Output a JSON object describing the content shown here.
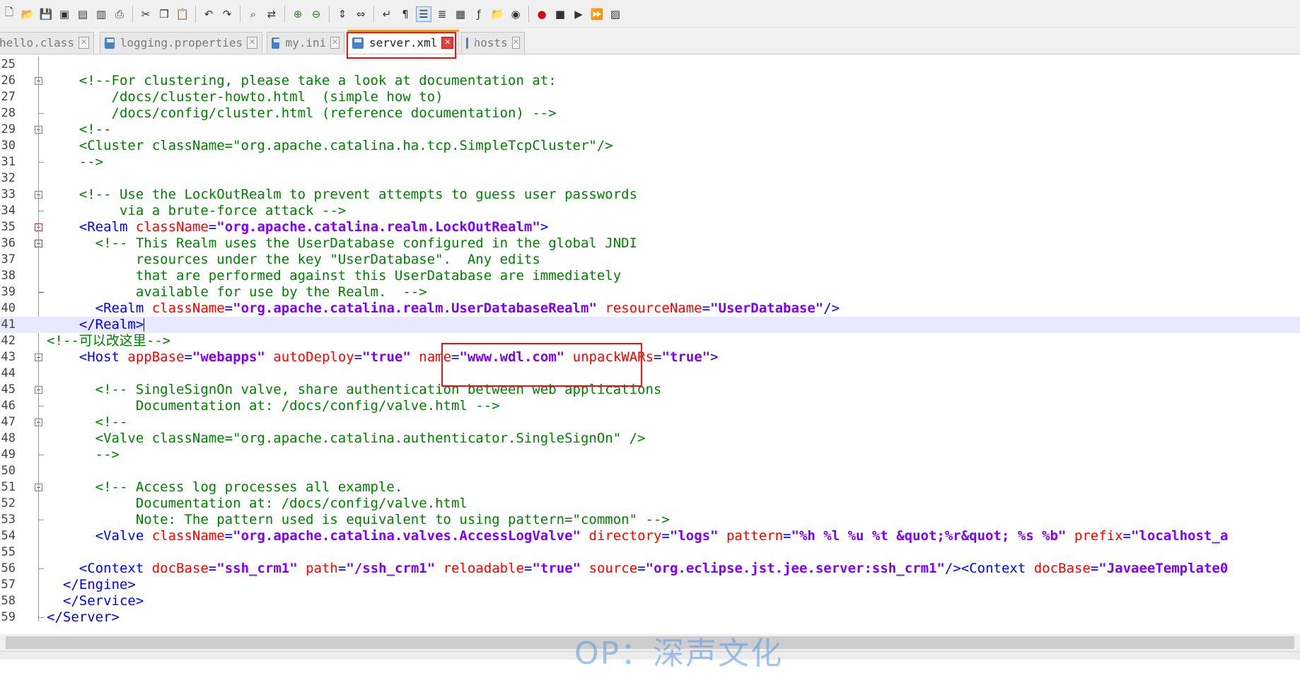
{
  "toolbar": {
    "icons": [
      "new-file-icon",
      "open-file-icon",
      "save-icon",
      "save-all-icon",
      "close-icon",
      "close-all-icon",
      "print-icon",
      "cut-icon",
      "copy-icon",
      "paste-icon",
      "undo-icon",
      "redo-icon",
      "find-icon",
      "replace-icon",
      "zoom-in-icon",
      "zoom-out-icon",
      "sync-vertical-icon",
      "sync-horizontal-icon",
      "word-wrap-icon",
      "show-all-chars-icon",
      "indent-guide-icon",
      "user-language-icon",
      "doc-map-icon",
      "function-list-icon",
      "folder-workspace-icon",
      "monitoring-icon",
      "record-macro-icon",
      "stop-macro-icon",
      "play-macro-icon",
      "run-macro-multiple-icon",
      "save-macro-icon"
    ]
  },
  "tabs": [
    {
      "label": "hello.class",
      "active": false
    },
    {
      "label": "logging.properties",
      "active": false
    },
    {
      "label": "my.ini",
      "active": false
    },
    {
      "label": "server.xml",
      "active": true
    },
    {
      "label": "hosts",
      "active": false
    }
  ],
  "editor": {
    "lines": [
      {
        "n": "25",
        "segs": []
      },
      {
        "n": "26",
        "segs": [
          [
            "cm",
            "    <!--For clustering, please take a look at documentation at:"
          ]
        ]
      },
      {
        "n": "27",
        "segs": [
          [
            "cm",
            "        /docs/cluster-howto.html  (simple how to)"
          ]
        ]
      },
      {
        "n": "28",
        "segs": [
          [
            "cm",
            "        /docs/config/cluster.html (reference documentation) -->"
          ]
        ]
      },
      {
        "n": "29",
        "segs": [
          [
            "cm",
            "    <!--"
          ]
        ]
      },
      {
        "n": "30",
        "segs": [
          [
            "cm",
            "    <Cluster className=\"org.apache.catalina.ha.tcp.SimpleTcpCluster\"/>"
          ]
        ]
      },
      {
        "n": "31",
        "segs": [
          [
            "cm",
            "    -->"
          ]
        ]
      },
      {
        "n": "32",
        "segs": []
      },
      {
        "n": "33",
        "segs": [
          [
            "cm",
            "    <!-- Use the LockOutRealm to prevent attempts to guess user passwords"
          ]
        ]
      },
      {
        "n": "34",
        "segs": [
          [
            "cm",
            "         via a brute-force attack -->"
          ]
        ]
      },
      {
        "n": "35",
        "segs": [
          [
            "tag",
            "    <Realm "
          ],
          [
            "attr",
            "className"
          ],
          [
            "tag",
            "="
          ],
          [
            "val",
            "\"org.apache.catalina.realm.LockOutRealm\""
          ],
          [
            "tag",
            ">"
          ]
        ]
      },
      {
        "n": "36",
        "segs": [
          [
            "cm",
            "      <!-- This Realm uses the UserDatabase configured in the global JNDI"
          ]
        ]
      },
      {
        "n": "37",
        "segs": [
          [
            "cm",
            "           resources under the key \"UserDatabase\".  Any edits"
          ]
        ]
      },
      {
        "n": "38",
        "segs": [
          [
            "cm",
            "           that are performed against this UserDatabase are immediately"
          ]
        ]
      },
      {
        "n": "39",
        "segs": [
          [
            "cm",
            "           available for use by the Realm.  -->"
          ]
        ]
      },
      {
        "n": "40",
        "segs": [
          [
            "tag",
            "      <Realm "
          ],
          [
            "attr",
            "className"
          ],
          [
            "tag",
            "="
          ],
          [
            "val",
            "\"org.apache.catalina.realm.UserDatabaseRealm\""
          ],
          [
            "tag",
            " "
          ],
          [
            "attr",
            "resourceName"
          ],
          [
            "tag",
            "="
          ],
          [
            "val",
            "\"UserDatabase\""
          ],
          [
            "tag",
            "/>"
          ]
        ]
      },
      {
        "n": "41",
        "segs": [
          [
            "tag",
            "    </Realm>"
          ]
        ]
      },
      {
        "n": "42",
        "segs": [
          [
            "cm",
            "<!--可以改这里-->"
          ]
        ]
      },
      {
        "n": "43",
        "segs": [
          [
            "tag",
            "    <Host "
          ],
          [
            "attr",
            "appBase"
          ],
          [
            "tag",
            "="
          ],
          [
            "val",
            "\"webapps\""
          ],
          [
            "tag",
            " "
          ],
          [
            "attr",
            "autoDeploy"
          ],
          [
            "tag",
            "="
          ],
          [
            "val",
            "\"true\""
          ],
          [
            "tag",
            " "
          ],
          [
            "attr",
            "name"
          ],
          [
            "tag",
            "="
          ],
          [
            "val",
            "\"www.wdl.com\""
          ],
          [
            "tag",
            " "
          ],
          [
            "attr",
            "unpackWARs"
          ],
          [
            "tag",
            "="
          ],
          [
            "val",
            "\"true\""
          ],
          [
            "tag",
            ">"
          ]
        ]
      },
      {
        "n": "44",
        "segs": []
      },
      {
        "n": "45",
        "segs": [
          [
            "cm",
            "      <!-- SingleSignOn valve, share authentication between web applications"
          ]
        ]
      },
      {
        "n": "46",
        "segs": [
          [
            "cm",
            "           Documentation at: /docs/config/valve.html -->"
          ]
        ]
      },
      {
        "n": "47",
        "segs": [
          [
            "cm",
            "      <!--"
          ]
        ]
      },
      {
        "n": "48",
        "segs": [
          [
            "cm",
            "      <Valve className=\"org.apache.catalina.authenticator.SingleSignOn\" />"
          ]
        ]
      },
      {
        "n": "49",
        "segs": [
          [
            "cm",
            "      -->"
          ]
        ]
      },
      {
        "n": "50",
        "segs": []
      },
      {
        "n": "51",
        "segs": [
          [
            "cm",
            "      <!-- Access log processes all example."
          ]
        ]
      },
      {
        "n": "52",
        "segs": [
          [
            "cm",
            "           Documentation at: /docs/config/valve.html"
          ]
        ]
      },
      {
        "n": "53",
        "segs": [
          [
            "cm",
            "           Note: The pattern used is equivalent to using pattern=\"common\" -->"
          ]
        ]
      },
      {
        "n": "54",
        "segs": [
          [
            "tag",
            "      <Valve "
          ],
          [
            "attr",
            "className"
          ],
          [
            "tag",
            "="
          ],
          [
            "val",
            "\"org.apache.catalina.valves.AccessLogValve\""
          ],
          [
            "tag",
            " "
          ],
          [
            "attr",
            "directory"
          ],
          [
            "tag",
            "="
          ],
          [
            "val",
            "\"logs\""
          ],
          [
            "tag",
            " "
          ],
          [
            "attr",
            "pattern"
          ],
          [
            "tag",
            "="
          ],
          [
            "val",
            "\"%h %l %u %t &quot;%r&quot; %s %b\""
          ],
          [
            "tag",
            " "
          ],
          [
            "attr",
            "prefix"
          ],
          [
            "tag",
            "="
          ],
          [
            "val",
            "\"localhost_a"
          ]
        ]
      },
      {
        "n": "55",
        "segs": []
      },
      {
        "n": "56",
        "segs": [
          [
            "tag",
            "    <Context "
          ],
          [
            "attr",
            "docBase"
          ],
          [
            "tag",
            "="
          ],
          [
            "val",
            "\"ssh_crm1\""
          ],
          [
            "tag",
            " "
          ],
          [
            "attr",
            "path"
          ],
          [
            "tag",
            "="
          ],
          [
            "val",
            "\"/ssh_crm1\""
          ],
          [
            "tag",
            " "
          ],
          [
            "attr",
            "reloadable"
          ],
          [
            "tag",
            "="
          ],
          [
            "val",
            "\"true\""
          ],
          [
            "tag",
            " "
          ],
          [
            "attr",
            "source"
          ],
          [
            "tag",
            "="
          ],
          [
            "val",
            "\"org.eclipse.jst.jee.server:ssh_crm1\""
          ],
          [
            "tag",
            "/><Context "
          ],
          [
            "attr",
            "docBase"
          ],
          [
            "tag",
            "="
          ],
          [
            "val",
            "\"JavaeeTemplate0"
          ]
        ]
      },
      {
        "n": "57",
        "segs": [
          [
            "tag",
            "  </Engine>"
          ]
        ]
      },
      {
        "n": "58",
        "segs": [
          [
            "tag",
            "  </Service>"
          ]
        ]
      },
      {
        "n": "59",
        "segs": [
          [
            "tag",
            "</Server>"
          ]
        ]
      }
    ],
    "current_line": "41"
  },
  "watermark": "OP：深声文化",
  "colors": {
    "comment": "#008000",
    "tag": "#0000ff",
    "attribute": "#ff0000",
    "value": "#8000ff",
    "highlight_box": "#e01818",
    "active_tab_accent": "#f39b2e"
  }
}
